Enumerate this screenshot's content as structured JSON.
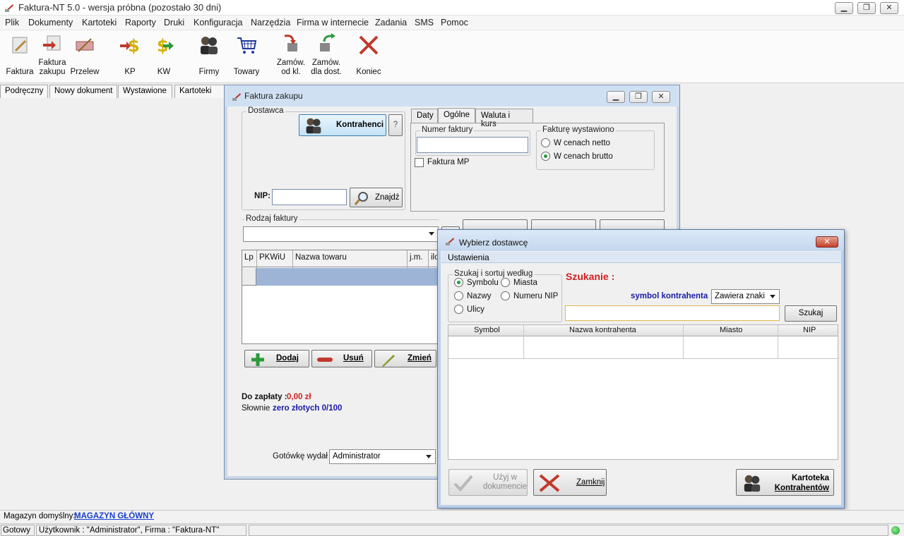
{
  "app": {
    "title": "Faktura-NT 5.0 - wersja próbna (pozostało 30 dni)"
  },
  "menu": [
    "Plik",
    "Dokumenty",
    "Kartoteki",
    "Raporty",
    "Druki",
    "Konfiguracja",
    "Narzędzia",
    "Firma w internecie",
    "Zadania",
    "SMS",
    "Pomoc"
  ],
  "toolbar": {
    "faktura": "Faktura",
    "faktura_zakupu_1": "Faktura",
    "faktura_zakupu_2": "zakupu",
    "przelew": "Przelew",
    "kp": "KP",
    "kw": "KW",
    "firmy": "Firmy",
    "towary": "Towary",
    "zam_od_kl_1": "Zamów.",
    "zam_od_kl_2": "od kl.",
    "zam_dla_dost_1": "Zamów.",
    "zam_dla_dost_2": "dla dost.",
    "koniec": "Koniec"
  },
  "doc_tabs": [
    "Podręczny",
    "Nowy dokument",
    "Wystawione",
    "Kartoteki"
  ],
  "invoice_window": {
    "title": "Faktura zakupu",
    "dostawca_label": "Dostawca",
    "kontrahenci_btn": "Kontrahenci",
    "help_btn": "?",
    "nip_label": "NIP:",
    "nip_value": "",
    "znajdz_btn": "Znajdź",
    "tabs": [
      "Daty",
      "Ogólne",
      "Waluta i kurs"
    ],
    "numer_faktury_label": "Numer faktury",
    "numer_faktury_value": "",
    "faktura_mp": "Faktura MP",
    "fakture_wystawiono_label": "Fakturę wystawiono",
    "radio_netto": "W cenach netto",
    "radio_brutto": "W cenach brutto",
    "rodzaj_faktury_label": "Rodzaj faktury",
    "rodzaj_faktury_value": "",
    "columns": [
      "Lp",
      "PKWiU",
      "Nazwa towaru",
      "j.m.",
      "ilo"
    ],
    "dodaj_btn": "Dodaj",
    "usun_btn": "Usuń",
    "zmien_btn": "Zmień",
    "do_zaplaty_label": "Do zapłaty :",
    "do_zaplaty_value": "0,00 zł",
    "slownie_label": "Słownie",
    "slownie_value": "zero złotych 0/100",
    "gotowke_label": "Gotówkę wydał",
    "gotowke_value": "Administrator"
  },
  "dialog": {
    "title": "Wybierz dostawcę",
    "ustawienia": "Ustawienia",
    "sort_group": "Szukaj i sortuj według",
    "radio_symbolu": "Symbolu",
    "radio_miasta": "Miasta",
    "radio_nazwy": "Nazwy",
    "radio_nip": "Numeru NIP",
    "radio_ulicy": "Ulicy",
    "szukanie": "Szukanie :",
    "symbol_kontrahenta": "symbol kontrahenta",
    "mode_value": "Zawiera znaki",
    "search_value": "",
    "szukaj_btn": "Szukaj",
    "columns": [
      "Symbol",
      "Nazwa kontrahenta",
      "Miasto",
      "NIP"
    ],
    "uzyj_1": "Użyj w",
    "uzyj_2": "dokumencie",
    "zamknij_btn": "Zamknij",
    "kartoteka_1": "Kartoteka",
    "kartoteka_2": "Kontrahentów"
  },
  "status": {
    "magazyn_label": "Magazyn domyślny:",
    "magazyn_value": "MAGAZYN GŁÓWNY",
    "gotowy": "Gotowy",
    "uzytkownik": "Użytkownik : \"Administrator\", Firma : \"Faktura-NT\""
  },
  "colors": {
    "red": "#d22020",
    "blue": "#1a1aa6",
    "link": "#1a3fcf",
    "select": "#9db4d6"
  }
}
